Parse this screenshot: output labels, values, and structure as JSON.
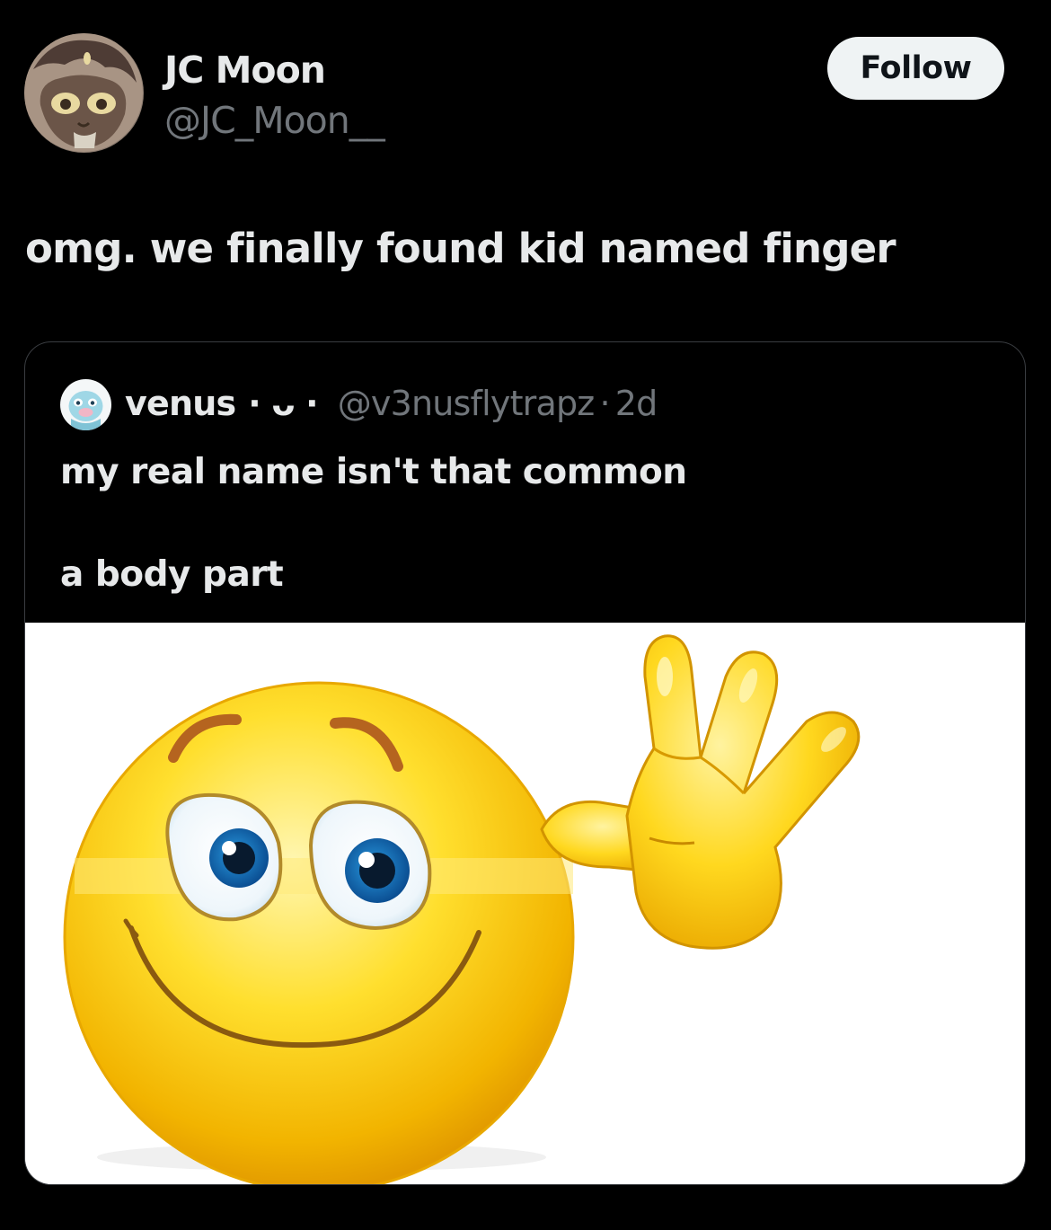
{
  "author": {
    "display_name": "JC Moon",
    "handle": "@JC_Moon__"
  },
  "follow_button": {
    "label": "Follow"
  },
  "tweet": {
    "text": "omg. we finally found kid named finger"
  },
  "quoted_tweet": {
    "display_name": "venus",
    "emote": "· ᴗ ·",
    "handle": "@v3nusflytrapz",
    "separator": "·",
    "time": "2d",
    "text_line1": "my real name isn't that common",
    "text_line2": "a body part",
    "media": {
      "description_icon": "waving-smiley-emoji-icon"
    }
  },
  "colors": {
    "background": "#000000",
    "primary_text": "#e7e9ea",
    "secondary_text": "#71767b",
    "follow_bg": "#eff3f4",
    "border": "#3a3d41"
  }
}
